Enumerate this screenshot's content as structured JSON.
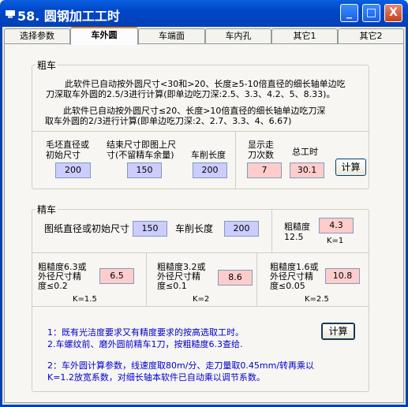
{
  "window": {
    "title": "58. 圆钢加工工时",
    "min_label": "_",
    "max_label": "□",
    "close_label": "X"
  },
  "tabs": [
    "选择参数",
    "车外圆",
    "车端面",
    "车内孔",
    "其它1",
    "其它2"
  ],
  "rough": {
    "legend": "粗车",
    "desc1_line1": "此软件已自动按外圆尺寸<30和>20、长度≥5-10倍直径的细长轴单边吃",
    "desc1_line2": "刀深取车外圆的2.5/3进行计算(即单边吃刀深:2.5、3.3、4.2、5、8.33)。",
    "desc2_line1": "此软件已自动按外圆尺寸≤20、长度>10倍直径的细长轴单边吃刀深",
    "desc2_line2": "取车外圆的2/3进行计算(即单边吃刀深:2、2.7、3.3、4、6.67)",
    "blank_label_1": "毛坯直径或",
    "blank_label_2": "初始尺寸",
    "blank_value": "200",
    "end_label_1": "结束尺寸即图上尺",
    "end_label_2": "寸(不留精车余量)",
    "end_value": "150",
    "length_label": "车削长度",
    "length_value": "200",
    "passes_label_1": "显示走",
    "passes_label_2": "刀次数",
    "passes_value": "7",
    "total_label": "总工时",
    "total_value": "30.1",
    "calc_label": "计算"
  },
  "finish": {
    "legend": "精车",
    "dia_label": "图纸直径或初始尺寸",
    "dia_value": "150",
    "length_label": "车削长度",
    "length_value": "200",
    "r125_label": "粗糙度",
    "r125_num": "12.5",
    "r125_value": "4.3",
    "r125_k": "K=1",
    "r63_label_1": "粗糙度6.3或",
    "r63_label_2": "外径尺寸精",
    "r63_label_3": "度≤0.2",
    "r63_value": "6.5",
    "r63_k": "K=1.5",
    "r32_label_1": "粗糙度3.2或",
    "r32_label_2": "外径尺寸精",
    "r32_label_3": "度≤0.1",
    "r32_value": "8.6",
    "r32_k": "K=2",
    "r16_label_1": "粗糙度1.6或",
    "r16_label_2": "外径尺寸精",
    "r16_label_3": "度≤0.05",
    "r16_value": "10.8",
    "r16_k": "K=2.5",
    "calc_label": "计算",
    "note1": "1：既有光洁度要求又有精度要求的按高选取工时。",
    "note2": "2.车螺纹前、磨外圆前精车1刀，按粗糙度6.3查给.",
    "note3": "2：车外圆计算参数，线速度取80m/分、走刀量取0.45mm/转再乘以",
    "note4": "K=1.2放宽系数，对细长轴本软件已自动乘以调节系数。"
  },
  "colors": {
    "input_blue": "#ccccff",
    "output_pink": "#ffcccc",
    "note_text": "#0000cc",
    "title_bar": "#0046c8"
  }
}
